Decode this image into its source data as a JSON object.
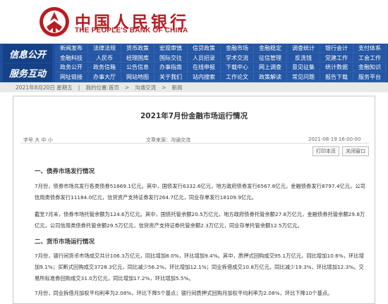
{
  "header": {
    "logo_cn": "中国人民银行",
    "logo_en": "THE PEOPLE'S BANK OF CHINA"
  },
  "nav": {
    "label_info": "信息公开",
    "label_service": "服务互动",
    "rows": [
      [
        "新闻发布",
        "法律法规",
        "货币政策",
        "宏观审慎",
        "信贷政策",
        "金融市场",
        "金融稳定",
        "调查统计",
        "银行会计",
        "支付体系"
      ],
      [
        "金融科技",
        "人民币",
        "经理国库",
        "国际交往",
        "人员招录",
        "学术交流",
        "征信管理",
        "反洗钱",
        "党建工作",
        "工会工作"
      ],
      [
        "政务公开",
        "政务信箱",
        "公告信息",
        "办事指南",
        "在线申报",
        "下载中心",
        "网上调查",
        "意见征集",
        "统计数据",
        "金融知识"
      ],
      [
        "网址链接",
        "办事大厅",
        "网站地图",
        "关于我们",
        "站内搜索",
        "工作论文",
        "政策解读",
        "常见问题",
        "报告下载",
        "服务平台"
      ]
    ]
  },
  "breadcrumb": {
    "date": "2021年8月20日 星期五",
    "path": [
      "我的位置:首页",
      "沟通交流",
      "新闻"
    ]
  },
  "article": {
    "title": "2021年7月份金融市场运行情况",
    "font_size_label": "字号 大 中 小",
    "source": "文章来源：沟通交流",
    "datetime": "2021-08-19 16:00:00",
    "print_label": "打印本页",
    "close_label": "关闭窗口",
    "section1_title": "一、债券市场发行情况",
    "p1": "7月份，债券市场共发行各类债券51669.1亿元。其中，国债发行6332.6亿元，地方政府债券发行6567.8亿元，金融债券发行8797.4亿元，公司信用类债券发行11184.0亿元，信贷资产支持证券发行264.7亿元，同业存单发行18109.9亿元。",
    "p2": "截至7月末，债券市场托管余额为124.6万亿元。其中，国债托管余额20.5万亿元，地方政府债券托管余额27.8万亿元，金融债券托管余额29.8万亿元，公司信用类债券托管余额29.5万亿元，信贷资产支持证券托管余额2.3万亿元，同业存单托管余额12.5万亿元。",
    "section2_title": "二、货币市场运行情况",
    "p3": "7月份，银行间货币市场成交共计106.3万亿元，同比增加8.0%，环比增加9.4%。其中，质押式回购成交95.1万亿元，同比增加10.6%，环比增加9.1%；买断式回购成交3728.3亿元，同比减少56.2%，环比增加12.1%；同业拆借成交10.8万亿元，同比减少19.3%，环比增加12.3%。交易所标准券回购成交31.0万亿元，同比增加17.2%，环比增加5.5%。",
    "p4": "7月份，同业拆借月加权平均利率为2.08%，环比下降5个基点；银行间质押式回购月加权平均利率为2.08%，环比下降10个基点。"
  }
}
